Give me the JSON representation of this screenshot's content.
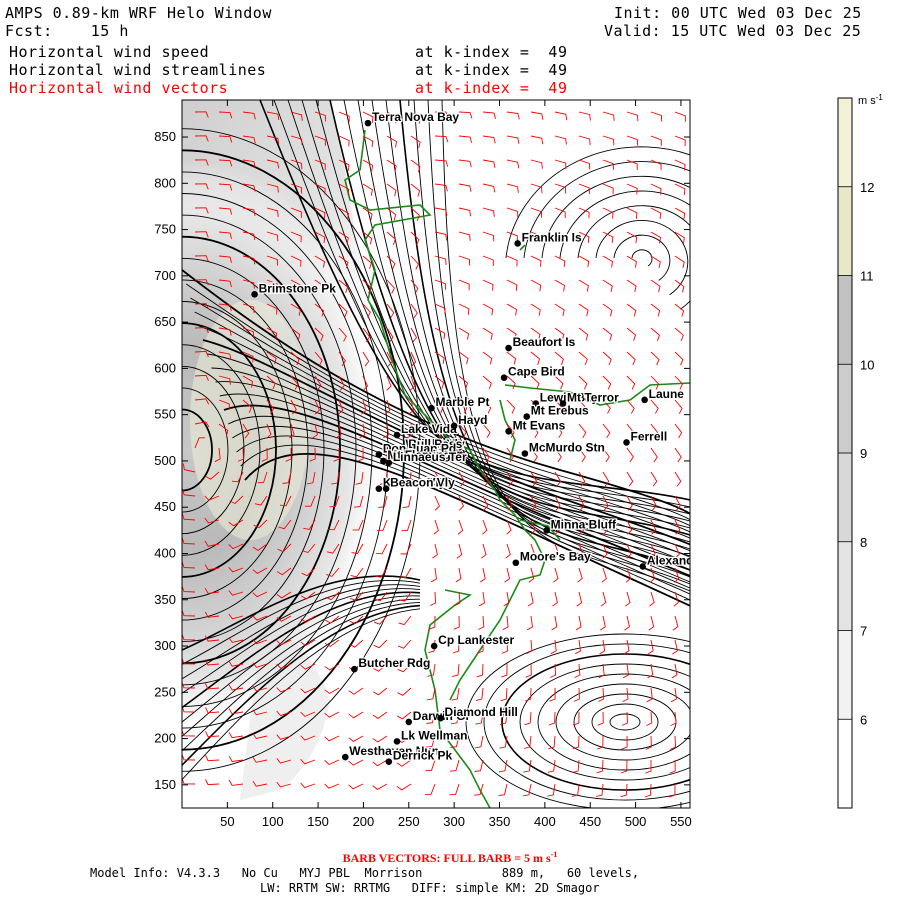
{
  "header": {
    "title": "AMPS 0.89-km WRF Helo Window",
    "init": "Init: 00 UTC Wed 03 Dec 25",
    "fcst": "Fcst:    15 h",
    "valid": "Valid: 15 UTC Wed 03 Dec 25",
    "fields": [
      {
        "name": "Horizontal wind speed",
        "level": "at k-index =  49",
        "color": "#000000"
      },
      {
        "name": "Horizontal wind streamlines",
        "level": "at k-index =  49",
        "color": "#000000"
      },
      {
        "name": "Horizontal wind vectors",
        "level": "at k-index =  49",
        "color": "#ff0000"
      }
    ]
  },
  "axes": {
    "x_ticks": [
      "50",
      "100",
      "150",
      "200",
      "250",
      "300",
      "350",
      "400",
      "450",
      "500",
      "550"
    ],
    "y_ticks": [
      "850",
      "800",
      "750",
      "700",
      "650",
      "600",
      "550",
      "500",
      "450",
      "400",
      "350",
      "300",
      "250",
      "200",
      "150"
    ],
    "xlim": [
      0,
      560
    ],
    "ylim": [
      125,
      890
    ]
  },
  "colorbar": {
    "unit": "m s",
    "unit_exp": "-1",
    "ticks": [
      "12",
      "11",
      "10",
      "9",
      "8",
      "7",
      "6"
    ],
    "levels": [
      {
        "from": 5,
        "to": 6,
        "color": "#ffffff"
      },
      {
        "from": 6,
        "to": 7,
        "color": "#f2f2f2"
      },
      {
        "from": 7,
        "to": 8,
        "color": "#e4e4e4"
      },
      {
        "from": 8,
        "to": 9,
        "color": "#d8d8d8"
      },
      {
        "from": 9,
        "to": 10,
        "color": "#cccccc"
      },
      {
        "from": 10,
        "to": 11,
        "color": "#c2c2c2"
      },
      {
        "from": 11,
        "to": 12,
        "color": "#e8e8c8"
      },
      {
        "from": 12,
        "to": 13,
        "color": "#f3f2d6"
      }
    ]
  },
  "places": [
    {
      "name": "Terra Nova Bay",
      "x": 205,
      "y": 865
    },
    {
      "name": "Franklin Is",
      "x": 370,
      "y": 735
    },
    {
      "name": "Brimstone Pk",
      "x": 80,
      "y": 680
    },
    {
      "name": "Beaufort Is",
      "x": 360,
      "y": 622
    },
    {
      "name": "Cape Bird",
      "x": 355,
      "y": 590
    },
    {
      "name": "Lewis Bay",
      "x": 390,
      "y": 562
    },
    {
      "name": "Mt Terror",
      "x": 420,
      "y": 562
    },
    {
      "name": "Laune",
      "x": 510,
      "y": 566
    },
    {
      "name": "Marble Pt",
      "x": 275,
      "y": 557
    },
    {
      "name": "Mt Erebus",
      "x": 380,
      "y": 548
    },
    {
      "name": "Lake Vida",
      "x": 237,
      "y": 528
    },
    {
      "name": "Hayd",
      "x": 300,
      "y": 538
    },
    {
      "name": "Mt Evans",
      "x": 360,
      "y": 532
    },
    {
      "name": "Wright Vly",
      "x": 242,
      "y": 512
    },
    {
      "name": "Bull Pass",
      "x": 245,
      "y": 512
    },
    {
      "name": "Don Juan Pd",
      "x": 217,
      "y": 507
    },
    {
      "name": "Ferrell",
      "x": 490,
      "y": 520
    },
    {
      "name": "McMurdo Stn",
      "x": 378,
      "y": 508
    },
    {
      "name": "Mt Fleming",
      "x": 222,
      "y": 500
    },
    {
      "name": "Linnaeus Ter",
      "x": 228,
      "y": 498
    },
    {
      "name": "Kennar Vly",
      "x": 217,
      "y": 470
    },
    {
      "name": "Beacon Vly",
      "x": 225,
      "y": 470
    },
    {
      "name": "Minna Bluff",
      "x": 402,
      "y": 425
    },
    {
      "name": "Moore's Bay",
      "x": 368,
      "y": 390
    },
    {
      "name": "Alexander",
      "x": 508,
      "y": 386
    },
    {
      "name": "Cp Lankester",
      "x": 278,
      "y": 300
    },
    {
      "name": "Butcher Rdg",
      "x": 190,
      "y": 275
    },
    {
      "name": "Darwin Gl",
      "x": 250,
      "y": 218
    },
    {
      "name": "Diamond Hill",
      "x": 285,
      "y": 222
    },
    {
      "name": "Lk Wellman",
      "x": 237,
      "y": 197
    },
    {
      "name": "Westhaven Nun",
      "x": 180,
      "y": 180
    },
    {
      "name": "Derrick Pk",
      "x": 228,
      "y": 175
    }
  ],
  "footer": {
    "barb": "BARB VECTORS:  FULL BARB = 5 m s",
    "barb_exp": "-1",
    "line1": "Model Info: V4.3.3   No Cu   MYJ PBL  Morrison           889 m,   60 levels,",
    "line2": "LW: RRTM SW: RRTMG   DIFF: simple KM: 2D Smagor"
  }
}
